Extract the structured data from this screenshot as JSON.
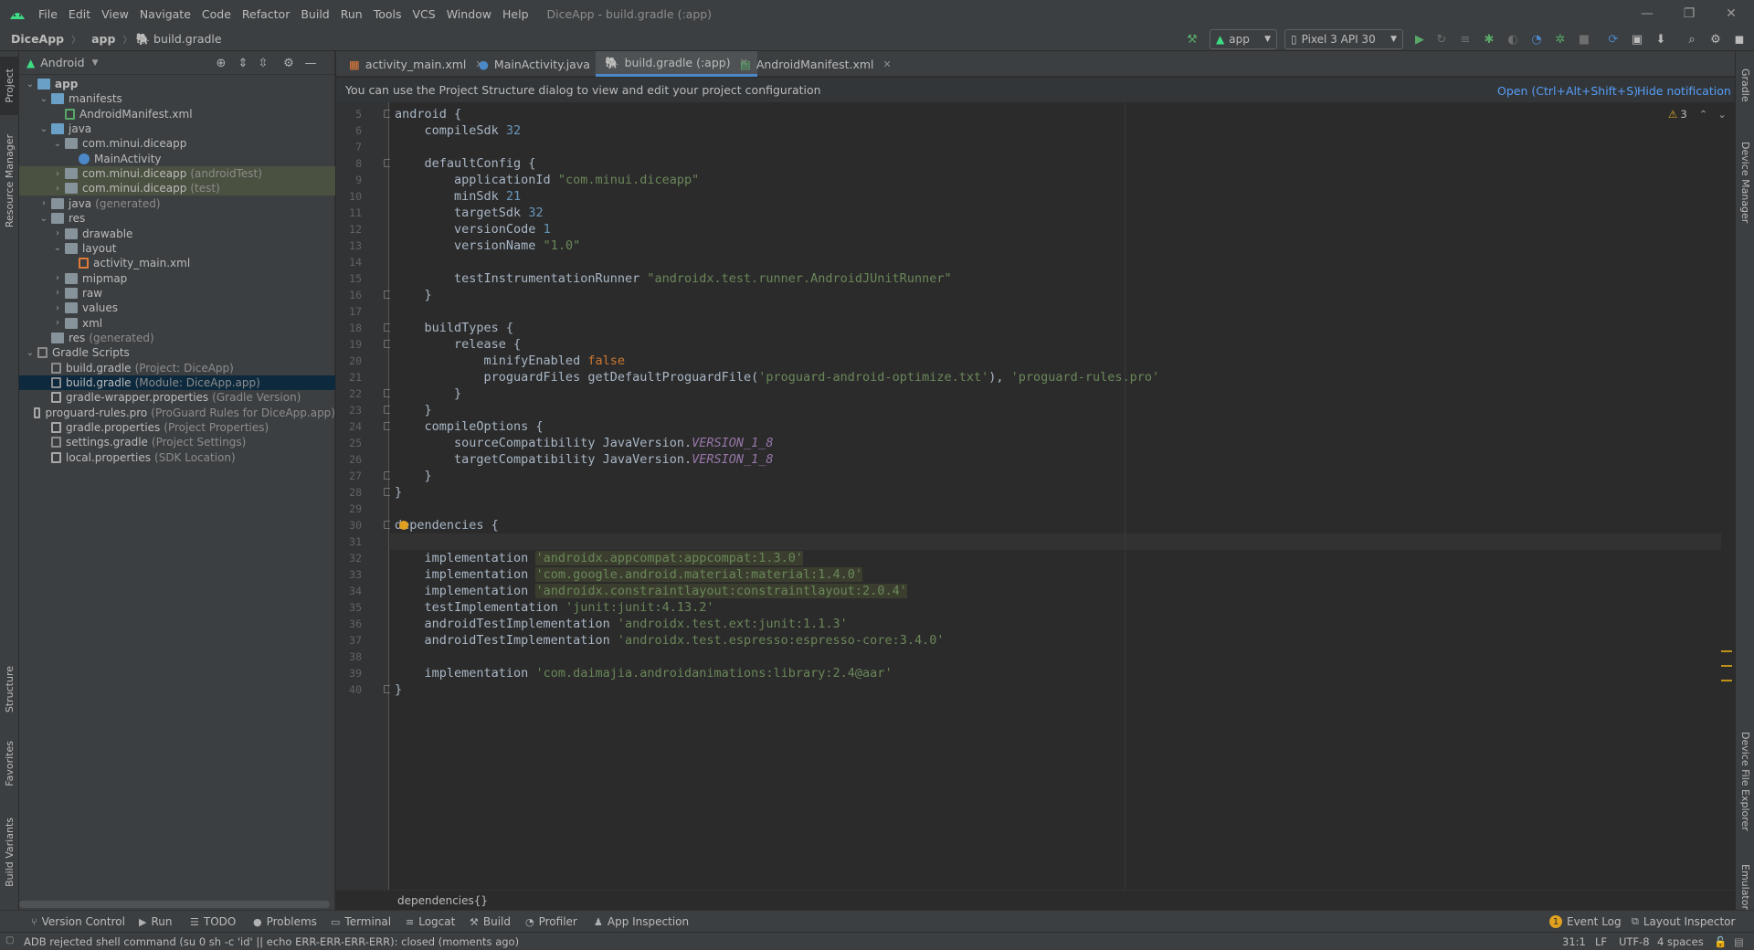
{
  "menubar": {
    "items": [
      "File",
      "Edit",
      "View",
      "Navigate",
      "Code",
      "Refactor",
      "Build",
      "Run",
      "Tools",
      "VCS",
      "Window",
      "Help"
    ],
    "window_title": "DiceApp - build.gradle (:app)"
  },
  "navbar": {
    "breadcrumb": [
      "DiceApp",
      "app",
      "build.gradle"
    ],
    "run_config": "app",
    "device": "Pixel 3 API 30"
  },
  "left_stripe": {
    "tabs": [
      "Project",
      "Resource Manager",
      "Structure",
      "Favorites",
      "Build Variants"
    ]
  },
  "right_stripe": {
    "tabs": [
      "Gradle",
      "Device Manager",
      "Device File Explorer",
      "Emulator"
    ]
  },
  "project": {
    "view_mode": "Android",
    "tree": [
      {
        "label": "app",
        "note": "",
        "level": 0,
        "arrow": "▾",
        "icon": "folder-blue",
        "bold": true
      },
      {
        "label": "manifests",
        "note": "",
        "level": 1,
        "arrow": "▾",
        "icon": "folder-blue"
      },
      {
        "label": "AndroidManifest.xml",
        "note": "",
        "level": 2,
        "arrow": "",
        "icon": "manifest"
      },
      {
        "label": "java",
        "note": "",
        "level": 1,
        "arrow": "▾",
        "icon": "folder-blue"
      },
      {
        "label": "com.minui.diceapp",
        "note": "",
        "level": 2,
        "arrow": "▾",
        "icon": "folder"
      },
      {
        "label": "MainActivity",
        "note": "",
        "level": 3,
        "arrow": "",
        "icon": "class"
      },
      {
        "label": "com.minui.diceapp",
        "note": "(androidTest)",
        "level": 2,
        "arrow": "▸",
        "icon": "folder",
        "hl": true
      },
      {
        "label": "com.minui.diceapp",
        "note": "(test)",
        "level": 2,
        "arrow": "▸",
        "icon": "folder",
        "hl": true
      },
      {
        "label": "java",
        "note": "(generated)",
        "level": 1,
        "arrow": "▸",
        "icon": "folder"
      },
      {
        "label": "res",
        "note": "",
        "level": 1,
        "arrow": "▾",
        "icon": "folder"
      },
      {
        "label": "drawable",
        "note": "",
        "level": 2,
        "arrow": "▸",
        "icon": "folder"
      },
      {
        "label": "layout",
        "note": "",
        "level": 2,
        "arrow": "▾",
        "icon": "folder"
      },
      {
        "label": "activity_main.xml",
        "note": "",
        "level": 3,
        "arrow": "",
        "icon": "xml"
      },
      {
        "label": "mipmap",
        "note": "",
        "level": 2,
        "arrow": "▸",
        "icon": "folder"
      },
      {
        "label": "raw",
        "note": "",
        "level": 2,
        "arrow": "▸",
        "icon": "folder"
      },
      {
        "label": "values",
        "note": "",
        "level": 2,
        "arrow": "▸",
        "icon": "folder"
      },
      {
        "label": "xml",
        "note": "",
        "level": 2,
        "arrow": "▸",
        "icon": "folder"
      },
      {
        "label": "res",
        "note": "(generated)",
        "level": 1,
        "arrow": "",
        "icon": "folder"
      },
      {
        "label": "Gradle Scripts",
        "note": "",
        "level": 0,
        "arrow": "▾",
        "icon": "gradle"
      },
      {
        "label": "build.gradle",
        "note": "(Project: DiceApp)",
        "level": 1,
        "arrow": "",
        "icon": "gradle"
      },
      {
        "label": "build.gradle",
        "note": "(Module: DiceApp.app)",
        "level": 1,
        "arrow": "",
        "icon": "gradle",
        "sel": true
      },
      {
        "label": "gradle-wrapper.properties",
        "note": "(Gradle Version)",
        "level": 1,
        "arrow": "",
        "icon": "props"
      },
      {
        "label": "proguard-rules.pro",
        "note": "(ProGuard Rules for DiceApp.app)",
        "level": 1,
        "arrow": "",
        "icon": "props"
      },
      {
        "label": "gradle.properties",
        "note": "(Project Properties)",
        "level": 1,
        "arrow": "",
        "icon": "props"
      },
      {
        "label": "settings.gradle",
        "note": "(Project Settings)",
        "level": 1,
        "arrow": "",
        "icon": "gradle"
      },
      {
        "label": "local.properties",
        "note": "(SDK Location)",
        "level": 1,
        "arrow": "",
        "icon": "props"
      }
    ]
  },
  "editor": {
    "tabs": [
      {
        "label": "activity_main.xml",
        "icon": "xml"
      },
      {
        "label": "MainActivity.java",
        "icon": "class"
      },
      {
        "label": "build.gradle (:app)",
        "icon": "gradle",
        "active": true
      },
      {
        "label": "AndroidManifest.xml",
        "icon": "manifest"
      }
    ],
    "notification": "You can use the Project Structure dialog to view and edit your project configuration",
    "notification_open": "Open (Ctrl+Alt+Shift+S)",
    "notification_hide": "Hide notification",
    "warning_count": "3",
    "breadcrumb": "dependencies{}",
    "lines": [
      {
        "n": "5",
        "t": [
          [
            "p",
            "android {"
          ]
        ]
      },
      {
        "n": "6",
        "t": [
          [
            "p",
            "    compileSdk "
          ],
          [
            "num",
            "32"
          ]
        ]
      },
      {
        "n": "7",
        "t": []
      },
      {
        "n": "8",
        "t": [
          [
            "p",
            "    defaultConfig {"
          ]
        ]
      },
      {
        "n": "9",
        "t": [
          [
            "p",
            "        applicationId "
          ],
          [
            "str",
            "\"com.minui.diceapp\""
          ]
        ]
      },
      {
        "n": "10",
        "t": [
          [
            "p",
            "        minSdk "
          ],
          [
            "num",
            "21"
          ]
        ]
      },
      {
        "n": "11",
        "t": [
          [
            "p",
            "        targetSdk "
          ],
          [
            "num",
            "32"
          ]
        ]
      },
      {
        "n": "12",
        "t": [
          [
            "p",
            "        versionCode "
          ],
          [
            "num",
            "1"
          ]
        ]
      },
      {
        "n": "13",
        "t": [
          [
            "p",
            "        versionName "
          ],
          [
            "str",
            "\"1.0\""
          ]
        ]
      },
      {
        "n": "14",
        "t": []
      },
      {
        "n": "15",
        "t": [
          [
            "p",
            "        testInstrumentationRunner "
          ],
          [
            "str",
            "\"androidx.test.runner.AndroidJUnitRunner\""
          ]
        ]
      },
      {
        "n": "16",
        "t": [
          [
            "p",
            "    }"
          ]
        ]
      },
      {
        "n": "17",
        "t": []
      },
      {
        "n": "18",
        "t": [
          [
            "p",
            "    buildTypes {"
          ]
        ]
      },
      {
        "n": "19",
        "t": [
          [
            "p",
            "        release {"
          ]
        ]
      },
      {
        "n": "20",
        "t": [
          [
            "p",
            "            minifyEnabled "
          ],
          [
            "kw",
            "false"
          ]
        ]
      },
      {
        "n": "21",
        "t": [
          [
            "p",
            "            proguardFiles getDefaultProguardFile("
          ],
          [
            "str",
            "'proguard-android-optimize.txt'"
          ],
          [
            "p",
            "), "
          ],
          [
            "str",
            "'proguard-rules.pro'"
          ]
        ]
      },
      {
        "n": "22",
        "t": [
          [
            "p",
            "        }"
          ]
        ]
      },
      {
        "n": "23",
        "t": [
          [
            "p",
            "    }"
          ]
        ]
      },
      {
        "n": "24",
        "t": [
          [
            "p",
            "    compileOptions {"
          ]
        ]
      },
      {
        "n": "25",
        "t": [
          [
            "p",
            "        sourceCompatibility JavaVersion."
          ],
          [
            "const",
            "VERSION_1_8"
          ]
        ]
      },
      {
        "n": "26",
        "t": [
          [
            "p",
            "        targetCompatibility JavaVersion."
          ],
          [
            "const",
            "VERSION_1_8"
          ]
        ]
      },
      {
        "n": "27",
        "t": [
          [
            "p",
            "    }"
          ]
        ]
      },
      {
        "n": "28",
        "t": [
          [
            "p",
            "}"
          ]
        ]
      },
      {
        "n": "29",
        "t": []
      },
      {
        "n": "30",
        "t": [
          [
            "p",
            "dependencies {"
          ]
        ]
      },
      {
        "n": "31",
        "t": [],
        "current": true
      },
      {
        "n": "32",
        "t": [
          [
            "p",
            "    implementation "
          ],
          [
            "strhl",
            "'androidx.appcompat:appcompat:1.3.0'"
          ]
        ]
      },
      {
        "n": "33",
        "t": [
          [
            "p",
            "    implementation "
          ],
          [
            "strhl",
            "'com.google.android.material:material:1.4.0'"
          ]
        ]
      },
      {
        "n": "34",
        "t": [
          [
            "p",
            "    implementation "
          ],
          [
            "strhl",
            "'androidx.constraintlayout:constraintlayout:2.0.4'"
          ]
        ]
      },
      {
        "n": "35",
        "t": [
          [
            "p",
            "    testImplementation "
          ],
          [
            "str",
            "'junit:junit:4.13.2'"
          ]
        ]
      },
      {
        "n": "36",
        "t": [
          [
            "p",
            "    androidTestImplementation "
          ],
          [
            "str",
            "'androidx.test.ext:junit:1.1.3'"
          ]
        ]
      },
      {
        "n": "37",
        "t": [
          [
            "p",
            "    androidTestImplementation "
          ],
          [
            "str",
            "'androidx.test.espresso:espresso-core:3.4.0'"
          ]
        ]
      },
      {
        "n": "38",
        "t": []
      },
      {
        "n": "39",
        "t": [
          [
            "p",
            "    implementation "
          ],
          [
            "str",
            "'com.daimajia.androidanimations:library:2.4@aar'"
          ]
        ]
      },
      {
        "n": "40",
        "t": [
          [
            "p",
            "}"
          ]
        ]
      }
    ]
  },
  "bottom_bar": {
    "left": [
      "Version Control",
      "Run",
      "TODO",
      "Problems",
      "Terminal",
      "Logcat",
      "Build",
      "Profiler",
      "App Inspection"
    ],
    "right": [
      "Event Log",
      "Layout Inspector"
    ],
    "event_badge": "1"
  },
  "status": {
    "message": "ADB rejected shell command (su 0 sh -c 'id' || echo ERR-ERR-ERR-ERR): closed (moments ago)",
    "position": "31:1",
    "line_sep": "LF",
    "encoding": "UTF-8",
    "indent": "4 spaces"
  },
  "colors": {
    "background": "#2b2b2b",
    "panel": "#3c3f41",
    "keyword": "#cc7832",
    "string": "#6a8759",
    "number": "#6897bb",
    "constant": "#9876aa",
    "selection": "#0d293e",
    "link": "#589df6",
    "android_green": "#3ddc84"
  }
}
